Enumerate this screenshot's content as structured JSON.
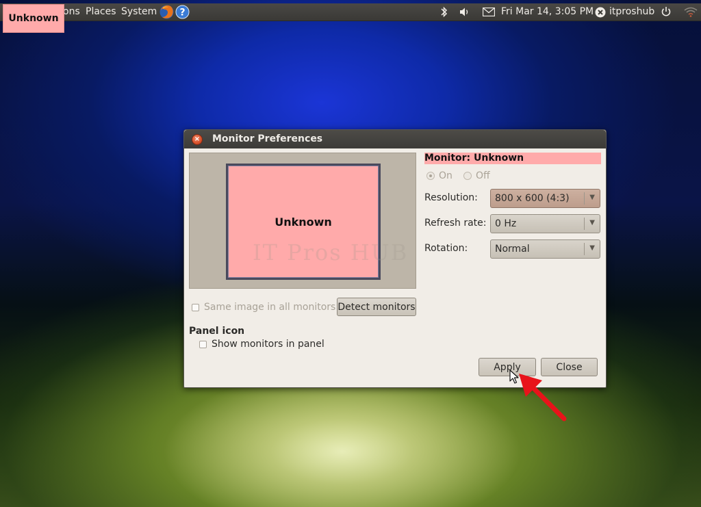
{
  "top_panel": {
    "applications_label": "ons",
    "places_label": "Places",
    "system_label": "System",
    "datetime": "Fri Mar 14,  3:05 PM",
    "username": "itproshub"
  },
  "overlay_tag": "Unknown",
  "dialog": {
    "title": "Monitor Preferences",
    "preview_monitor_label": "Unknown",
    "watermark": "IT Pros HUB",
    "same_image_label": "Same image in all monitors",
    "detect_button": "Detect monitors",
    "panel_icon_heading": "Panel icon",
    "show_in_panel_label": "Show monitors in panel",
    "monitor_name": "Monitor: Unknown",
    "on_label": "On",
    "off_label": "Off",
    "resolution_label": "Resolution:",
    "resolution_value": "800 x 600 (4:3)",
    "refresh_label": "Refresh rate:",
    "refresh_value": "0 Hz",
    "rotation_label": "Rotation:",
    "rotation_value": "Normal",
    "apply_button": "Apply",
    "close_button": "Close"
  },
  "colors": {
    "highlight_pink": "#ffaaaa",
    "arrow_red": "#e8131a",
    "close_orange": "#d9512b"
  },
  "icons": [
    "firefox-icon",
    "help-icon",
    "bluetooth-icon",
    "volume-icon",
    "mail-icon",
    "user-status-icon",
    "power-icon",
    "wifi-icon",
    "window-close-icon",
    "mouse-cursor-icon",
    "red-arrow-icon"
  ]
}
